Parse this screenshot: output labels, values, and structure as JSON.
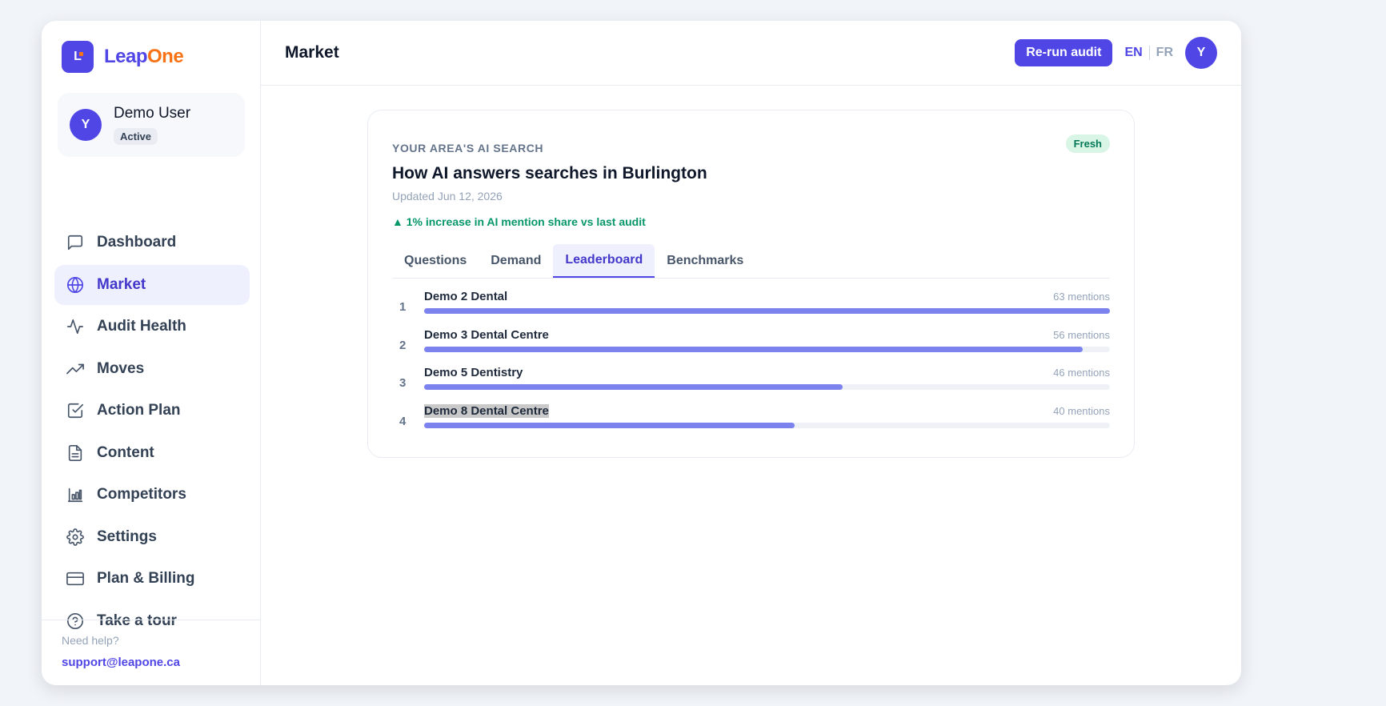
{
  "brand": {
    "name_part1": "Leap",
    "name_part2": "One",
    "mark_letter": "L"
  },
  "user": {
    "initial": "Y",
    "name": "Demo User",
    "status": "Active"
  },
  "nav": [
    {
      "label": "Dashboard",
      "icon": "message-square-icon",
      "active": false
    },
    {
      "label": "Market",
      "icon": "globe-icon",
      "active": true
    },
    {
      "label": "Audit Health",
      "icon": "activity-icon",
      "active": false
    },
    {
      "label": "Moves",
      "icon": "trending-up-icon",
      "active": false
    },
    {
      "label": "Action Plan",
      "icon": "check-square-icon",
      "active": false
    },
    {
      "label": "Content",
      "icon": "file-text-icon",
      "active": false
    },
    {
      "label": "Competitors",
      "icon": "bar-chart-icon",
      "active": false
    },
    {
      "label": "Settings",
      "icon": "gear-icon",
      "active": false
    },
    {
      "label": "Plan & Billing",
      "icon": "credit-card-icon",
      "active": false
    }
  ],
  "tour": {
    "label": "Take a tour",
    "icon": "help-circle-icon"
  },
  "help": {
    "question": "Need help?",
    "email": "support@leapone.ca"
  },
  "topbar": {
    "title": "Market",
    "rerun_label": "Re-run audit",
    "lang_en": "EN",
    "lang_fr": "FR",
    "avatar_initial": "Y"
  },
  "card": {
    "eyebrow": "YOUR AREA'S AI SEARCH",
    "badge": "Fresh",
    "title": "How AI answers searches in Burlington",
    "updated": "Updated Jun 12, 2026",
    "delta": "▲ 1% increase in AI mention share vs last audit",
    "tabs": [
      {
        "label": "Questions",
        "active": false
      },
      {
        "label": "Demand",
        "active": false
      },
      {
        "label": "Leaderboard",
        "active": true
      },
      {
        "label": "Benchmarks",
        "active": false
      }
    ],
    "leaderboard": [
      {
        "rank": "1",
        "name": "Demo 2 Dental",
        "mentions_label": "63 mentions",
        "mentions": 63,
        "share": 1.0
      },
      {
        "rank": "2",
        "name": "Demo 3 Dental Centre",
        "mentions_label": "56 mentions",
        "mentions": 56,
        "share": 0.96
      },
      {
        "rank": "3",
        "name": "Demo 5 Dentistry",
        "mentions_label": "46 mentions",
        "mentions": 46,
        "share": 0.61
      },
      {
        "rank": "4",
        "name": "Demo 8 Dental Centre",
        "mentions_label": "40 mentions",
        "mentions": 40,
        "share": 0.54,
        "selected": true
      }
    ]
  },
  "colors": {
    "accent": "#4f46e5",
    "brand_orange": "#f97316",
    "bar_fill": "#7c83ee",
    "success": "#059669"
  }
}
